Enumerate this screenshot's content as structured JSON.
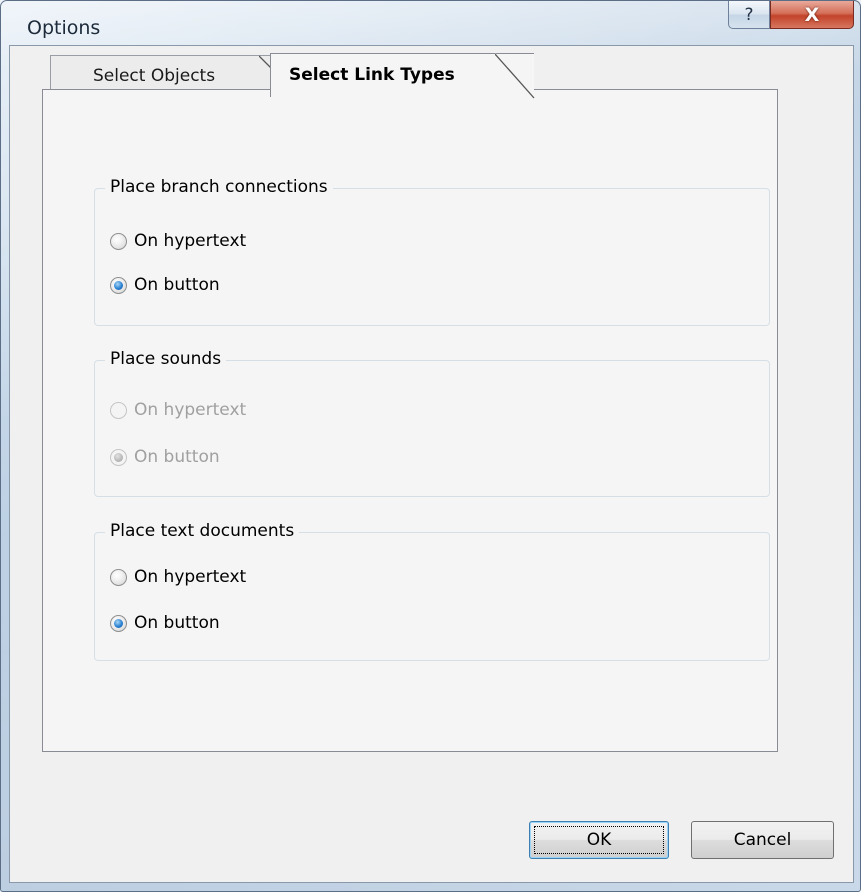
{
  "window": {
    "title": "Options",
    "help_glyph": "?",
    "close_glyph": "X"
  },
  "tabs": [
    {
      "label": "Select Objects",
      "active": false
    },
    {
      "label": "Select Link Types",
      "active": true
    }
  ],
  "groups": {
    "branch": {
      "legend": "Place branch connections",
      "enabled": true,
      "options": [
        {
          "label": "On hypertext",
          "selected": false
        },
        {
          "label": "On button",
          "selected": true
        }
      ]
    },
    "sounds": {
      "legend": "Place sounds",
      "enabled": false,
      "options": [
        {
          "label": "On hypertext",
          "selected": false
        },
        {
          "label": "On button",
          "selected": true
        }
      ]
    },
    "text_docs": {
      "legend": "Place text documents",
      "enabled": true,
      "options": [
        {
          "label": "On hypertext",
          "selected": false
        },
        {
          "label": "On button",
          "selected": true
        }
      ]
    }
  },
  "buttons": {
    "ok": "OK",
    "cancel": "Cancel"
  },
  "colors": {
    "accent_radio": "#2b82d2",
    "close_button": "#c2432a",
    "disabled_text": "#a0a0a0"
  }
}
